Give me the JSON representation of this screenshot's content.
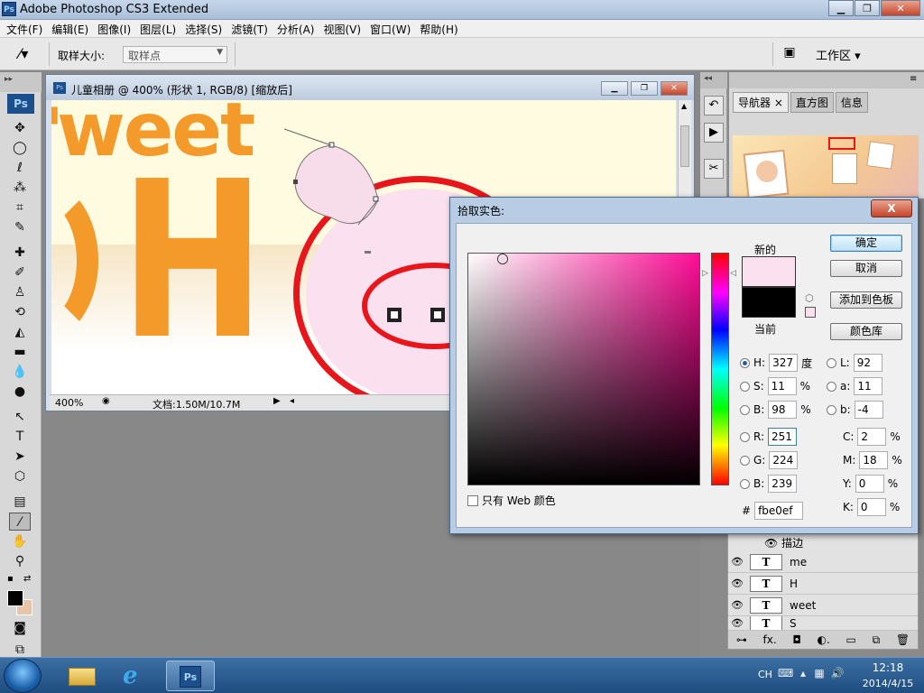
{
  "window": {
    "title": "Adobe Photoshop CS3 Extended",
    "logo": "Ps"
  },
  "menus": [
    "文件(F)",
    "编辑(E)",
    "图像(I)",
    "图层(L)",
    "选择(S)",
    "滤镜(T)",
    "分析(A)",
    "视图(V)",
    "窗口(W)",
    "帮助(H)"
  ],
  "options": {
    "sample_label": "取样大小:",
    "sample_value": "取样点",
    "workspace": "工作区 ▾"
  },
  "tools": {
    "logo": "Ps"
  },
  "document": {
    "title": "儿童相册 @ 400% (形状 1, RGB/8) [缩放后]",
    "zoom": "400%",
    "info": "文档:1.50M/10.7M",
    "art_text_1": "weet",
    "art_text_2": "H",
    "art_text_3": "'"
  },
  "navigator": {
    "tabs": [
      "导航器 ×",
      "直方图",
      "信息"
    ]
  },
  "layers": {
    "fx_row": "描边",
    "items": [
      {
        "icon": "T",
        "name": "me"
      },
      {
        "icon": "T",
        "name": "H"
      },
      {
        "icon": "T",
        "name": "weet"
      },
      {
        "icon": "T",
        "name": "S"
      }
    ],
    "bottom_icons": [
      "⊶",
      "fx.",
      "◘",
      "◐.",
      "▭",
      "⧉",
      "🗑"
    ]
  },
  "color_picker": {
    "title": "拾取实色:",
    "close": "X",
    "new_label": "新的",
    "current_label": "当前",
    "new_color": "#fbe0ef",
    "current_color": "#000000",
    "buttons": {
      "ok": "确定",
      "cancel": "取消",
      "add_swatch": "添加到色板",
      "libraries": "颜色库"
    },
    "web_only": "只有 Web 颜色",
    "hsb": {
      "H": "327",
      "S": "11",
      "B": "98",
      "h_unit": "度",
      "s_unit": "%",
      "b_unit": "%"
    },
    "lab": {
      "L": "92",
      "a": "11",
      "b": "-4"
    },
    "rgb": {
      "R": "251",
      "G": "224",
      "B": "239"
    },
    "cmyk": {
      "C": "2",
      "M": "18",
      "Y": "0",
      "K": "0",
      "unit": "%"
    },
    "hex_label": "#",
    "hex": "fbe0ef",
    "labels": {
      "H": "H:",
      "S": "S:",
      "B": "B:",
      "L": "L:",
      "a": "a:",
      "b": "b:",
      "R": "R:",
      "G": "G:",
      "Bb": "B:",
      "C": "C:",
      "M": "M:",
      "Y": "Y:",
      "K": "K:"
    }
  },
  "taskbar": {
    "items": [
      "file-explorer",
      "internet-explorer",
      "photoshop"
    ],
    "lang": "CH",
    "time": "12:18",
    "date": "2014/4/15"
  }
}
